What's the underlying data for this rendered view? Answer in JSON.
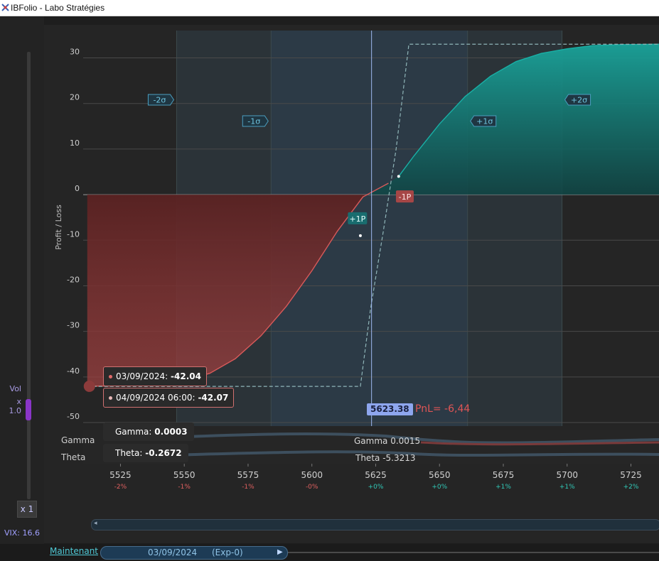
{
  "window": {
    "title": "IBFolio - Labo Stratégies"
  },
  "left_panel": {
    "vol_label": "Vol",
    "vol_multiplier": "x 1.0",
    "vol_level": 1.0,
    "x_button": "x 1",
    "vix": "VIX: 16.6"
  },
  "bottom": {
    "now_link": "Maintenant",
    "date": "03/09/2024",
    "exp": "(Exp-0)"
  },
  "chart_data": {
    "type": "line",
    "ylabel": "Profit / Loss",
    "ylim": [
      -50,
      36
    ],
    "xlim": [
      5509,
      5736
    ],
    "y_ticks": [
      30,
      20,
      10,
      0,
      -10,
      -20,
      -30,
      -40,
      -50
    ],
    "x_ticks": [
      "5525",
      "5550",
      "5575",
      "5600",
      "5625",
      "5650",
      "5675",
      "5700",
      "5725"
    ],
    "x_tick_values": [
      5525,
      5550,
      5575,
      5600,
      5625,
      5650,
      5675,
      5700,
      5725
    ],
    "x_pct": [
      "-2%",
      "-1%",
      "-1%",
      "-0%",
      "+0%",
      "+0%",
      "+1%",
      "+1%",
      "+2%"
    ],
    "sigma_labels": {
      "m2": "-2σ",
      "m1": "-1σ",
      "p1": "+1σ",
      "p2": "+2σ"
    },
    "sigma_values": {
      "m2": 5547,
      "m1": 5584,
      "p1": 5661,
      "p2": 5698
    },
    "current_price": 5623.38,
    "current_price_label": "5623.38",
    "pnl_label": "PnL= -6,44",
    "series": [
      {
        "x": [
          5512,
          5520,
          5530,
          5540,
          5550,
          5560,
          5570,
          5580,
          5590,
          5600,
          5610,
          5620,
          5630,
          5634,
          5640,
          5650,
          5660,
          5670,
          5680,
          5690,
          5700,
          5710,
          5720,
          5736
        ],
        "y": [
          -42.0,
          -42.0,
          -41.8,
          -41.5,
          -40.8,
          -39.2,
          -36.0,
          -31.0,
          -24.5,
          -16.7,
          -8.0,
          -0.5,
          2.5,
          4.0,
          8.5,
          15.5,
          21.5,
          26.0,
          29.2,
          31.0,
          32.0,
          32.7,
          32.9,
          33.0
        ]
      },
      {
        "x": [
          5512,
          5619,
          5623,
          5628,
          5633,
          5638,
          5736
        ],
        "y": [
          -42.07,
          -42.07,
          -25,
          -8,
          10,
          33.0,
          33.0
        ]
      }
    ],
    "markers": [
      {
        "label": "+1P",
        "x": 5618,
        "y": -9
      },
      {
        "label": "-1P",
        "x": 5636,
        "y": 0
      }
    ],
    "tooltips": [
      {
        "date": "03/09/2024:",
        "value": "-42.04"
      },
      {
        "date": "04/09/2024 06:00:",
        "value": "-42.07"
      }
    ],
    "greeks": {
      "gamma_label": "Gamma",
      "theta_label": "Theta",
      "gamma_tooltip_label": "Gamma:",
      "gamma_tooltip_value": "0.0003",
      "theta_tooltip_label": "Theta:",
      "theta_tooltip_value": "-0.2672",
      "gamma_center": "Gamma 0.0015",
      "theta_center": "Theta -5.3213"
    }
  }
}
